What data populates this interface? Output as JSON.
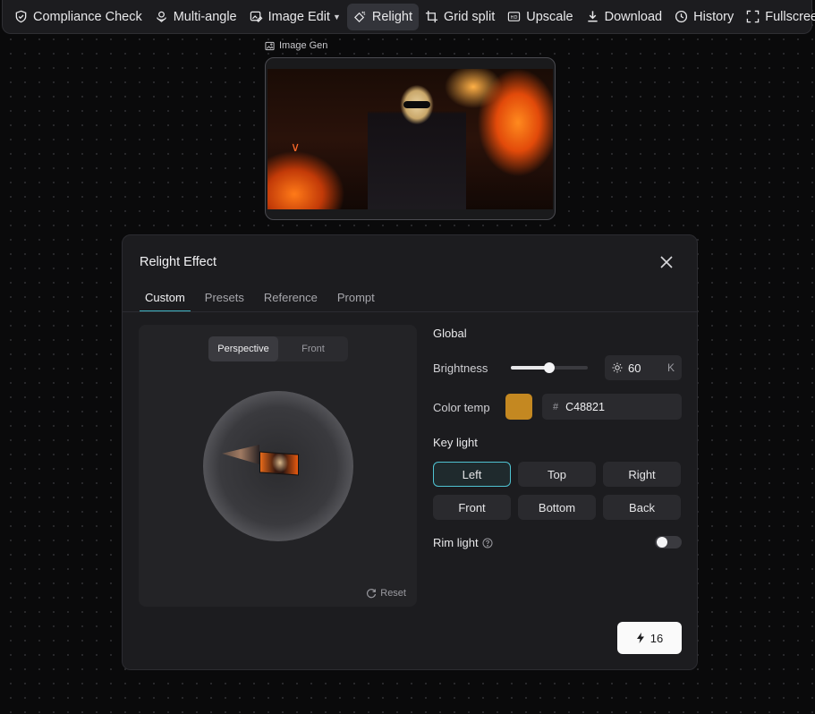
{
  "toolbar": {
    "items": [
      {
        "label": "Compliance Check",
        "icon": "shield-check-icon"
      },
      {
        "label": "Multi-angle",
        "icon": "multi-angle-icon"
      },
      {
        "label": "Image Edit",
        "icon": "image-edit-icon"
      },
      {
        "label": "Relight",
        "icon": "relight-icon"
      },
      {
        "label": "Grid split",
        "icon": "crop-icon"
      },
      {
        "label": "Upscale",
        "icon": "hd-icon"
      },
      {
        "label": "Download",
        "icon": "download-icon"
      },
      {
        "label": "History",
        "icon": "clock-icon"
      },
      {
        "label": "Fullscreen",
        "icon": "fullscreen-icon"
      }
    ],
    "active_item": "Relight"
  },
  "node": {
    "label": "Image Gen"
  },
  "dialog": {
    "title": "Relight Effect",
    "tabs": [
      "Custom",
      "Presets",
      "Reference",
      "Prompt"
    ],
    "active_tab": "Custom",
    "preview": {
      "view_modes": [
        "Perspective",
        "Front"
      ],
      "active_view": "Perspective",
      "reset_label": "Reset"
    },
    "global": {
      "title": "Global",
      "brightness_label": "Brightness",
      "brightness_value": "60",
      "brightness_fraction": 0.5,
      "brightness_unit": "K",
      "color_temp_label": "Color temp",
      "color_hex": "C48821",
      "color_swatch": "#C48821"
    },
    "key_light": {
      "title": "Key light",
      "options": [
        "Left",
        "Top",
        "Right",
        "Front",
        "Bottom",
        "Back"
      ],
      "selected": "Left"
    },
    "rim_light": {
      "label": "Rim light",
      "enabled": false
    },
    "generate": {
      "cost": "16"
    }
  },
  "colors": {
    "accent": "#4fc3d2",
    "panel": "#1c1c1f"
  }
}
